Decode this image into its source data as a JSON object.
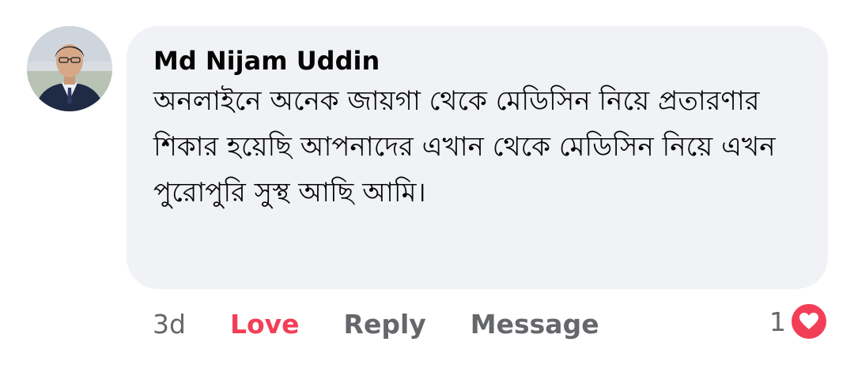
{
  "comment": {
    "author": "Md Nijam Uddin",
    "text": "অনলাইনে অনেক জায়গা থেকে মেডিসিন নিয়ে প্রতারণার শিকার হয়েছি আপনাদের এখান থেকে মেডিসিন নিয়ে এখন পুরোপুরি সুস্থ আছি আমি।",
    "timestamp": "3d",
    "reaction_label": "Love",
    "reply_label": "Reply",
    "message_label": "Message",
    "reaction_count": "1",
    "reaction_icon": "heart-icon"
  },
  "colors": {
    "bubble_bg": "#f0f2f5",
    "love": "#f33e58",
    "meta_text": "#65676b",
    "body_text": "#050505"
  }
}
